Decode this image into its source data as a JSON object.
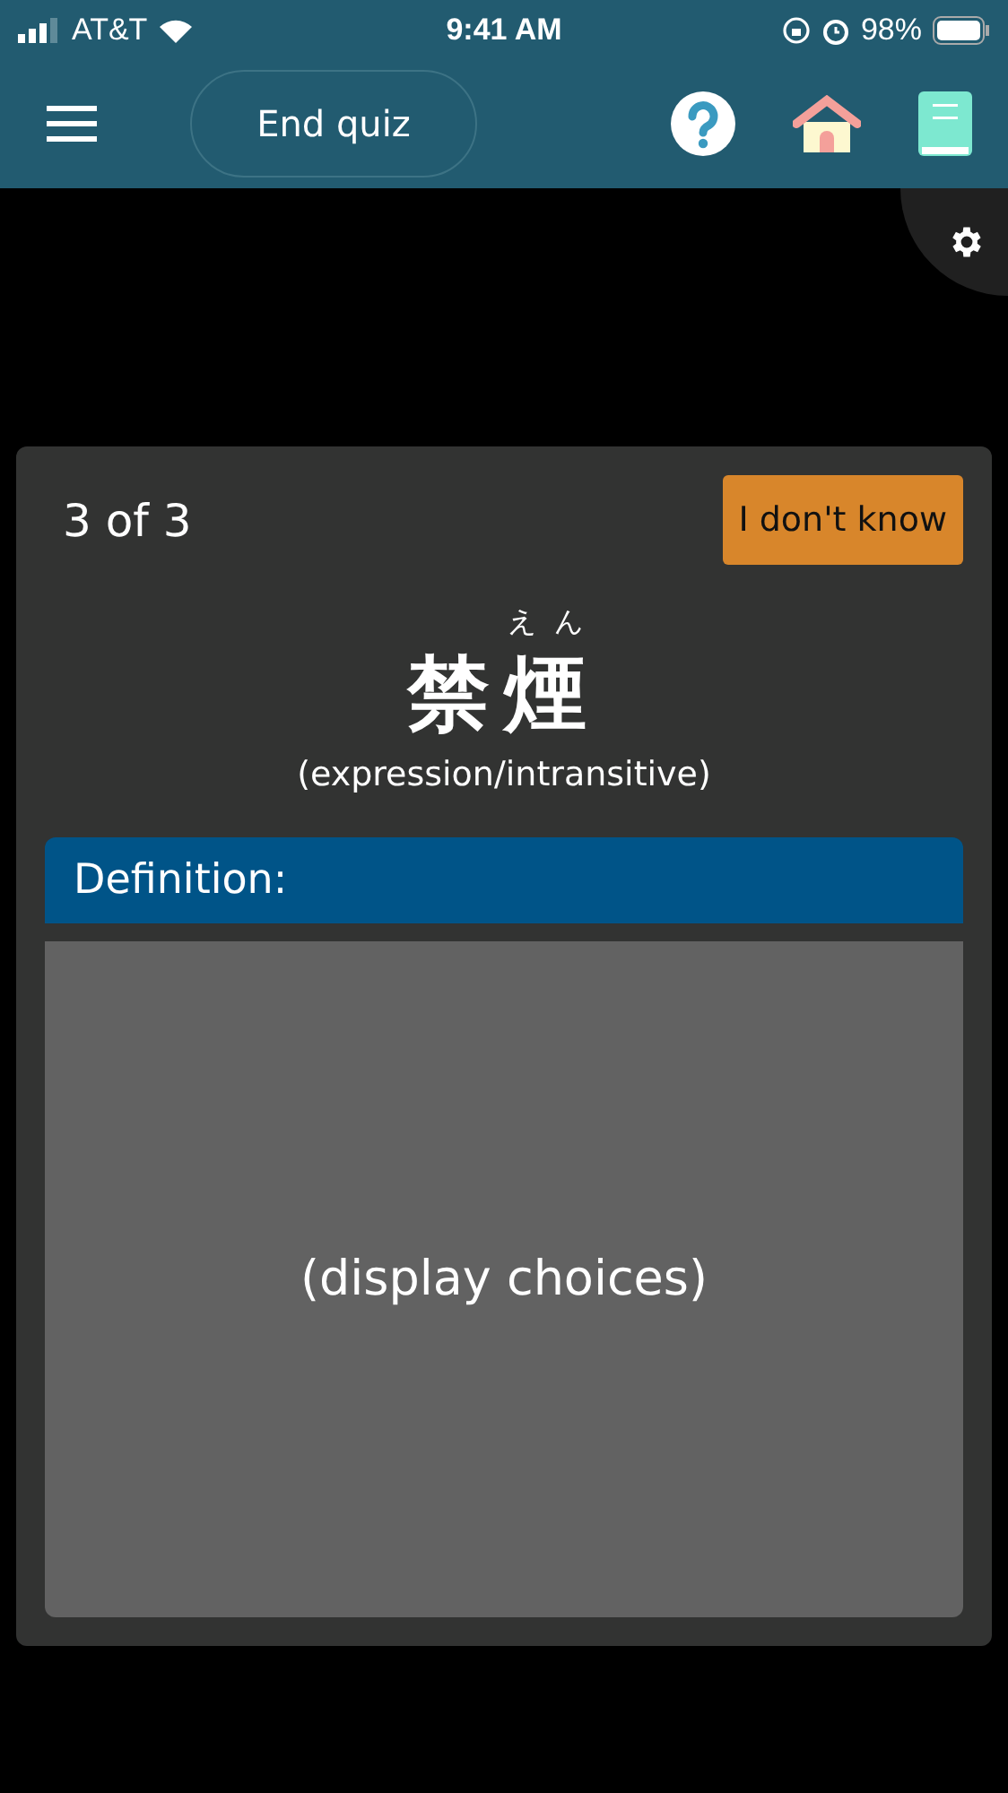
{
  "status_bar": {
    "carrier": "AT&T",
    "time": "9:41 AM",
    "battery": "98%"
  },
  "toolbar": {
    "end_button": "End quiz"
  },
  "card": {
    "progress": "3 of 3",
    "dont_know_button": "I don't know",
    "word_parts": [
      {
        "text": "禁"
      },
      {
        "text": "煙",
        "reading": "えん"
      }
    ],
    "part_of_speech": "(expression/intransitive)",
    "definition_label": "Definition:",
    "choices_placeholder": "(display choices)"
  }
}
